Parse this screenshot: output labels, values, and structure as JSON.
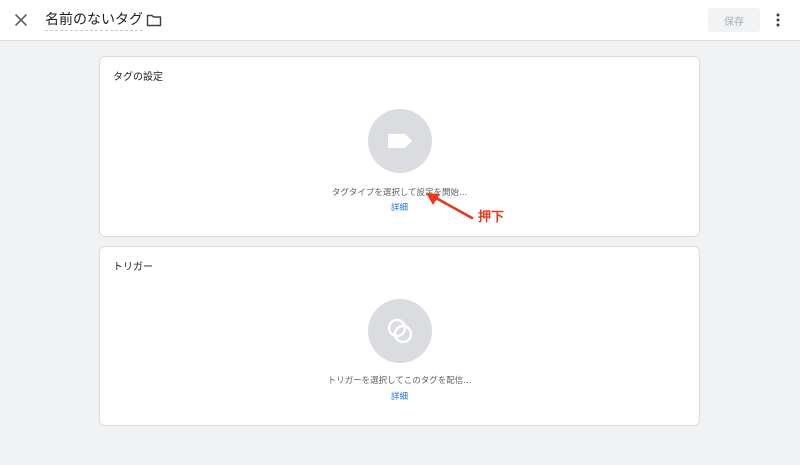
{
  "header": {
    "close_icon": "close-icon",
    "tag_name": "名前のないタグ",
    "folder_icon": "folder-icon",
    "save_label": "保存",
    "more_icon": "more-vert-icon"
  },
  "tag_config": {
    "heading": "タグの設定",
    "icon": "tag-icon",
    "hint": "タグタイプを選択して設定を開始...",
    "detail_link": "詳細"
  },
  "triggering": {
    "heading": "トリガー",
    "icon": "trigger-icon",
    "hint": "トリガーを選択してこのタグを配信...",
    "detail_link": "詳細"
  },
  "annotation": {
    "label": "押下",
    "color": "#e8391a"
  },
  "colors": {
    "background": "#f1f2f3",
    "card": "#ffffff",
    "icon_circle": "#dadce0",
    "link": "#1a73e8"
  }
}
